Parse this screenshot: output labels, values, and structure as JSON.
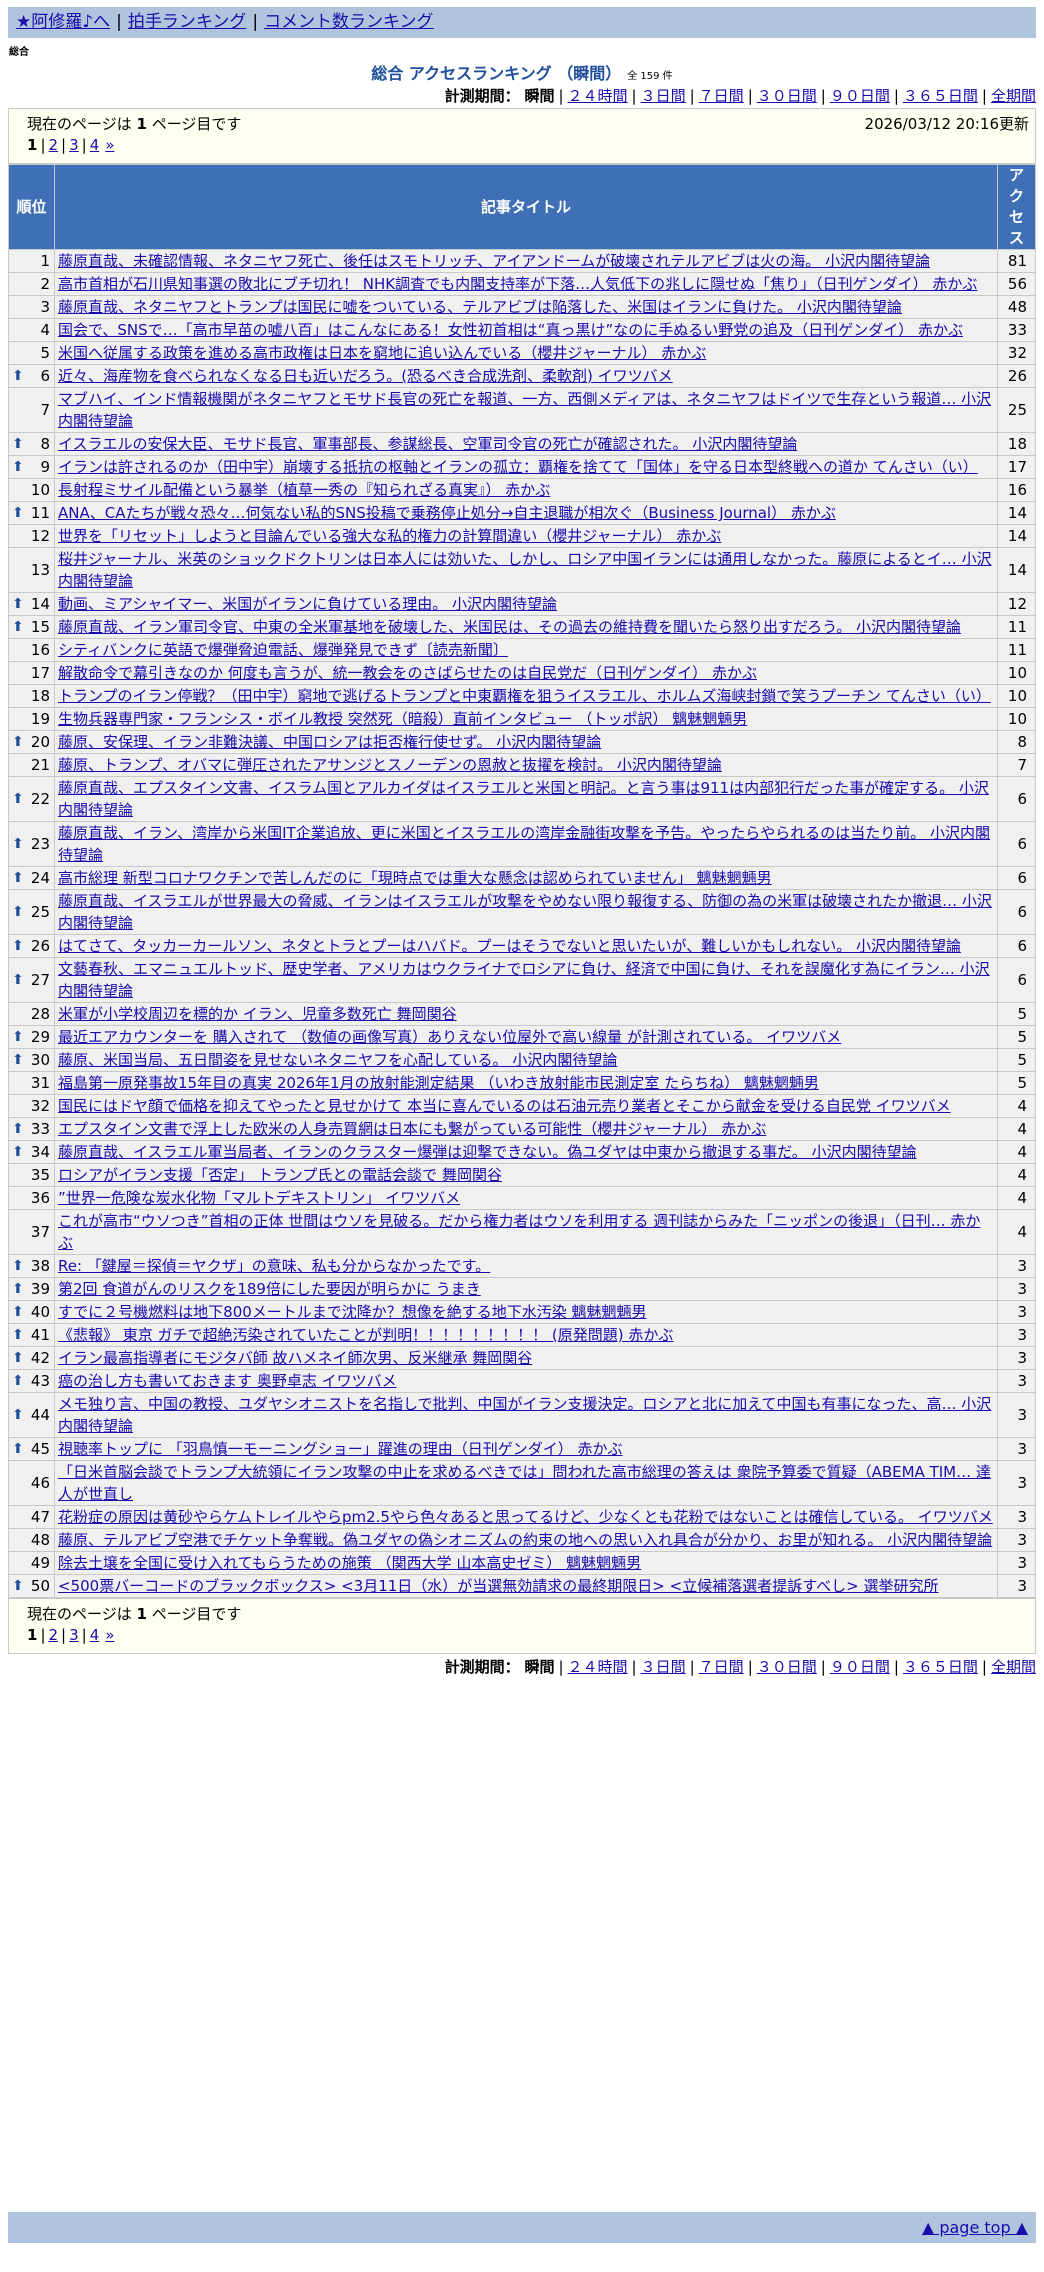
{
  "topnav": {
    "home": "★阿修羅♪へ",
    "clap": "拍手ランキング",
    "comment": "コメント数ランキング"
  },
  "category": "総合",
  "ranking_title": "総合 アクセスランキング （瞬間）",
  "total": "全 159 件",
  "period": {
    "label": "計測期間：",
    "current": "瞬間",
    "options": [
      "２４時間",
      "３日間",
      "７日間",
      "３０日間",
      "９０日間",
      "３６５日間",
      "全期間"
    ]
  },
  "current_page_text": {
    "prefix": "現在のページは ",
    "page": "1",
    "suffix": " ページ目です"
  },
  "updated": "2026/03/12 20:16更新",
  "pager": {
    "current": "1",
    "pages": [
      "2",
      "3",
      "4"
    ],
    "next": "»"
  },
  "table": {
    "headers": {
      "rank": "順位",
      "title": "記事タイトル",
      "access": "アクセス"
    },
    "rows": [
      {
        "rank": "1",
        "up": false,
        "title": "藤原直哉、未確認情報、ネタニヤフ死亡、後任はスモトリッチ、アイアンドームが破壊されテルアビブは火の海。 小沢内閣待望論",
        "count": "81"
      },
      {
        "rank": "2",
        "up": false,
        "title": "高市首相が石川県知事選の敗北にブチ切れ！ NHK調査でも内閣支持率が下落…人気低下の兆しに隠せぬ「焦り」（日刊ゲンダイ） 赤かぶ",
        "count": "56"
      },
      {
        "rank": "3",
        "up": false,
        "title": "藤原直哉、ネタニヤフとトランプは国民に嘘をついている、テルアビブは陥落した、米国はイランに負けた。 小沢内閣待望論",
        "count": "48"
      },
      {
        "rank": "4",
        "up": false,
        "title": "国会で、SNSで…「高市早苗の嘘八百」はこんなにある！女性初首相は“真っ黒け”なのに手ぬるい野党の追及（日刊ゲンダイ） 赤かぶ",
        "count": "33"
      },
      {
        "rank": "5",
        "up": false,
        "title": "米国へ従属する政策を進める高市政権は日本を窮地に追い込んでいる（櫻井ジャーナル） 赤かぶ",
        "count": "32"
      },
      {
        "rank": "6",
        "up": true,
        "title": "近々、海産物を食べられなくなる日も近いだろう。(恐るべき合成洗剤、柔軟剤) イワツバメ",
        "count": "26"
      },
      {
        "rank": "7",
        "up": false,
        "title": "マブハイ、インド情報機関がネタニヤフとモサド長官の死亡を報道、一方、西側メディアは、ネタニヤフはドイツで生存という報道… 小沢内閣待望論",
        "count": "25"
      },
      {
        "rank": "8",
        "up": true,
        "title": "イスラエルの安保大臣、モサド長官、軍事部長、参謀総長、空軍司令官の死亡が確認された。 小沢内閣待望論",
        "count": "18"
      },
      {
        "rank": "9",
        "up": true,
        "title": "イランは許されるのか（田中宇）崩壊する抵抗の枢軸とイランの孤立：覇権を捨てて「国体」を守る日本型終戦への道か てんさい（い）",
        "count": "17"
      },
      {
        "rank": "10",
        "up": false,
        "title": "長射程ミサイル配備という暴挙（植草一秀の『知られざる真実』） 赤かぶ",
        "count": "16"
      },
      {
        "rank": "11",
        "up": true,
        "title": "ANA、CAたちが戦々恐々…何気ない私的SNS投稿で乗務停止処分→自主退職が相次ぐ（Business Journal） 赤かぶ",
        "count": "14"
      },
      {
        "rank": "12",
        "up": false,
        "title": "世界を「リセット」しようと目論んでいる強大な私的権力の計算間違い（櫻井ジャーナル） 赤かぶ",
        "count": "14"
      },
      {
        "rank": "13",
        "up": false,
        "title": "桜井ジャーナル、米英のショックドクトリンは日本人には効いた、しかし、ロシア中国イランには通用しなかった。藤原によるとイ… 小沢内閣待望論",
        "count": "14"
      },
      {
        "rank": "14",
        "up": true,
        "title": "動画、ミアシャイマー、米国がイランに負けている理由。 小沢内閣待望論",
        "count": "12"
      },
      {
        "rank": "15",
        "up": true,
        "title": "藤原直哉、イラン軍司令官、中東の全米軍基地を破壊した、米国民は、その過去の維持費を聞いたら怒り出すだろう。 小沢内閣待望論",
        "count": "11"
      },
      {
        "rank": "16",
        "up": false,
        "title": "シティバンクに英語で爆弾脅迫電話、爆弾発見できず〔読売新聞〕",
        "count": "11"
      },
      {
        "rank": "17",
        "up": false,
        "title": "解散命令で幕引きなのか 何度も言うが、統一教会をのさばらせたのは自民党だ（日刊ゲンダイ） 赤かぶ",
        "count": "10"
      },
      {
        "rank": "18",
        "up": false,
        "title": "トランプのイラン停戦？（田中宇）窮地で逃げるトランプと中東覇権を狙うイスラエル、ホルムズ海峡封鎖で笑うプーチン てんさい（い）",
        "count": "10"
      },
      {
        "rank": "19",
        "up": false,
        "title": "生物兵器専門家・フランシス・ボイル教授 突然死（暗殺）直前インタビュー （トッポ訳） 魑魅魍魎男",
        "count": "10"
      },
      {
        "rank": "20",
        "up": true,
        "title": "藤原、安保理、イラン非難決議、中国ロシアは拒否権行使せず。 小沢内閣待望論",
        "count": "8"
      },
      {
        "rank": "21",
        "up": false,
        "title": "藤原、トランプ、オバマに弾圧されたアサンジとスノーデンの恩赦と抜擢を検討。 小沢内閣待望論",
        "count": "7"
      },
      {
        "rank": "22",
        "up": true,
        "title": "藤原直哉、エプスタイン文書、イスラム国とアルカイダはイスラエルと米国と明記。と言う事は911は内部犯行だった事が確定する。 小沢内閣待望論",
        "count": "6"
      },
      {
        "rank": "23",
        "up": true,
        "title": "藤原直哉、イラン、湾岸から米国IT企業追放、更に米国とイスラエルの湾岸金融街攻撃を予告。やったらやられるのは当たり前。 小沢内閣待望論",
        "count": "6"
      },
      {
        "rank": "24",
        "up": true,
        "title": "高市総理 新型コロナワクチンで苦しんだのに「現時点では重大な懸念は認められていません」 魑魅魍魎男",
        "count": "6"
      },
      {
        "rank": "25",
        "up": true,
        "title": "藤原直哉、イスラエルが世界最大の脅威、イランはイスラエルが攻撃をやめない限り報復する、防御の為の米軍は破壊されたか撤退… 小沢内閣待望論",
        "count": "6"
      },
      {
        "rank": "26",
        "up": true,
        "title": "はてさて、タッカーカールソン、ネタとトラとプーはハバド。プーはそうでないと思いたいが、難しいかもしれない。 小沢内閣待望論",
        "count": "6"
      },
      {
        "rank": "27",
        "up": true,
        "title": "文藝春秋、エマニュエルトッド、歴史学者、アメリカはウクライナでロシアに負け、経済で中国に負け、それを誤魔化す為にイラン… 小沢内閣待望論",
        "count": "6"
      },
      {
        "rank": "28",
        "up": false,
        "title": "米軍が小学校周辺を標的か イラン、児童多数死亡 舞岡関谷",
        "count": "5"
      },
      {
        "rank": "29",
        "up": true,
        "title": "最近エアカウンターを 購入されて （数値の画像写真）ありえない位屋外で高い線量 が計測されている。 イワツバメ",
        "count": "5"
      },
      {
        "rank": "30",
        "up": true,
        "title": "藤原、米国当局、五日間姿を見せないネタニヤフを心配している。 小沢内閣待望論",
        "count": "5"
      },
      {
        "rank": "31",
        "up": false,
        "title": "福島第一原発事故15年目の真実 2026年1月の放射能測定結果 （いわき放射能市民測定室 たらちね） 魑魅魍魎男",
        "count": "5"
      },
      {
        "rank": "32",
        "up": false,
        "title": "国民にはドヤ顔で価格を抑えてやったと見せかけて 本当に喜んでいるのは石油元売り業者とそこから献金を受ける自民党 イワツバメ",
        "count": "4"
      },
      {
        "rank": "33",
        "up": true,
        "title": "エプスタイン文書で浮上した欧米の人身売買網は日本にも繋がっている可能性（櫻井ジャーナル） 赤かぶ",
        "count": "4"
      },
      {
        "rank": "34",
        "up": true,
        "title": "藤原直哉、イスラエル軍当局者、イランのクラスター爆弾は迎撃できない。偽ユダヤは中東から撤退する事だ。 小沢内閣待望論",
        "count": "4"
      },
      {
        "rank": "35",
        "up": false,
        "title": "ロシアがイラン支援「否定」 トランプ氏との電話会談で 舞岡関谷",
        "count": "4"
      },
      {
        "rank": "36",
        "up": false,
        "title": "”世界一危険な炭水化物「マルトデキストリン」 イワツバメ",
        "count": "4"
      },
      {
        "rank": "37",
        "up": false,
        "title": "これが高市“ウソつき”首相の正体 世間はウソを見破る。だから権力者はウソを利用する 週刊誌からみた「ニッポンの後退」（日刊… 赤かぶ",
        "count": "4"
      },
      {
        "rank": "38",
        "up": true,
        "title": "Re: 「鍵屋＝探偵＝ヤクザ」の意味、私も分からなかったです。",
        "count": "3"
      },
      {
        "rank": "39",
        "up": true,
        "title": "第2回 食道がんのリスクを189倍にした要因が明らかに うまき",
        "count": "3"
      },
      {
        "rank": "40",
        "up": true,
        "title": "すでに２号機燃料は地下800メートルまで沈降か？想像を絶する地下水汚染 魑魅魍魎男",
        "count": "3"
      },
      {
        "rank": "41",
        "up": true,
        "title": "《悲報》 東京 ガチで超絶汚染されていたことが判明！！！！！！！！！ (原発問題) 赤かぶ",
        "count": "3"
      },
      {
        "rank": "42",
        "up": true,
        "title": "イラン最高指導者にモジタバ師 故ハメネイ師次男、反米継承 舞岡関谷",
        "count": "3"
      },
      {
        "rank": "43",
        "up": true,
        "title": "癌の治し方も書いておきます 奥野卓志 イワツバメ",
        "count": "3"
      },
      {
        "rank": "44",
        "up": true,
        "title": "メモ独り言、中国の教授、ユダヤシオニストを名指しで批判、中国がイラン支援決定。ロシアと北に加えて中国も有事になった、高… 小沢内閣待望論",
        "count": "3"
      },
      {
        "rank": "45",
        "up": true,
        "title": "視聴率トップに 「羽鳥慎一モーニングショー」躍進の理由（日刊ゲンダイ） 赤かぶ",
        "count": "3"
      },
      {
        "rank": "46",
        "up": false,
        "title": "「日米首脳会談でトランプ大統領にイラン攻撃の中止を求めるべきでは」問われた高市総理の答えは 衆院予算委で質疑（ABEMA TIM… 達人が世直し",
        "count": "3"
      },
      {
        "rank": "47",
        "up": false,
        "title": "花粉症の原因は黄砂やらケムトレイルやらpm2.5やら色々あると思ってるけど、少なくとも花粉ではないことは確信している。 イワツバメ",
        "count": "3"
      },
      {
        "rank": "48",
        "up": false,
        "title": "藤原、テルアビブ空港でチケット争奪戦。偽ユダヤの偽シオニズムの約束の地への思い入れ具合が分かり、お里が知れる。 小沢内閣待望論",
        "count": "3"
      },
      {
        "rank": "49",
        "up": false,
        "title": "除去土壌を全国に受け入れてもらうための施策 （関西大学 山本高史ゼミ） 魑魅魍魎男",
        "count": "3"
      },
      {
        "rank": "50",
        "up": true,
        "title": "<500票バーコードのブラックボックス> <3月11日（水）が当選無効請求の最終期限日> <立候補落選者提訴すべし> 選挙研究所",
        "count": "3"
      }
    ]
  },
  "page_top": "▲ page top ▲"
}
